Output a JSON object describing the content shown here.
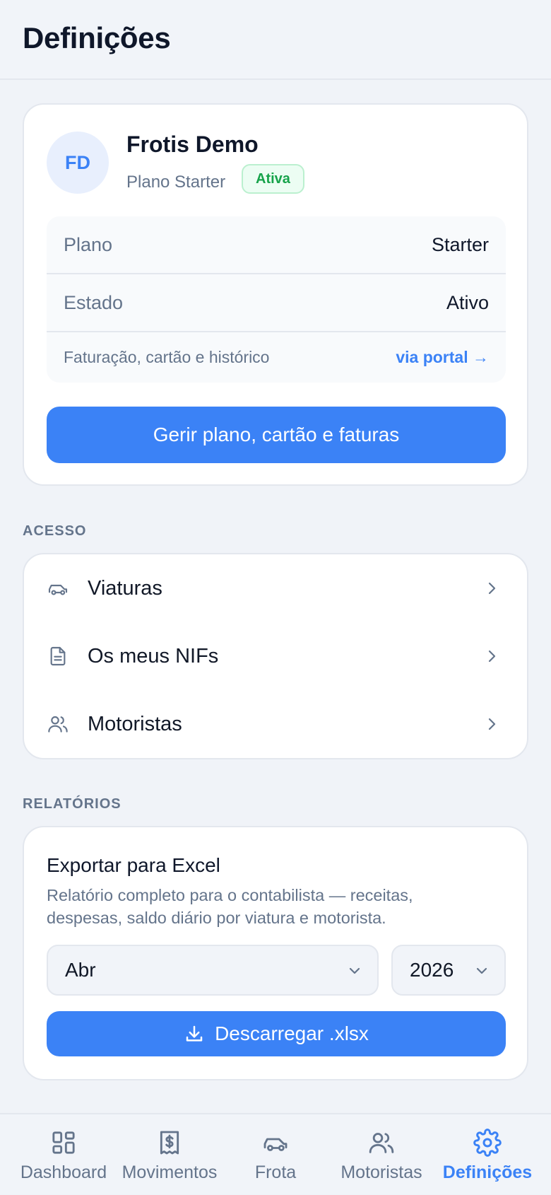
{
  "header": {
    "title": "Definições"
  },
  "account": {
    "initials": "FD",
    "name": "Frotis Demo",
    "plan_line": "Plano Starter",
    "status_badge": "Ativa",
    "details": [
      {
        "label": "Plano",
        "value": "Starter"
      },
      {
        "label": "Estado",
        "value": "Ativo"
      }
    ],
    "billing": {
      "label": "Faturação, cartão e histórico",
      "link": "via portal →"
    },
    "manage_button": "Gerir plano, cartão e faturas"
  },
  "access": {
    "section_label": "ACESSO",
    "items": [
      {
        "label": "Viaturas",
        "icon": "car-icon"
      },
      {
        "label": "Os meus NIFs",
        "icon": "document-icon"
      },
      {
        "label": "Motoristas",
        "icon": "users-icon"
      }
    ]
  },
  "reports": {
    "section_label": "RELATÓRIOS",
    "title": "Exportar para Excel",
    "description": "Relatório completo para o contabilista — receitas, despesas, saldo diário por viatura e motorista.",
    "month": "Abr",
    "year": "2026",
    "download_button": "Descarregar .xlsx"
  },
  "tabbar": {
    "items": [
      {
        "label": "Dashboard",
        "icon": "dashboard-icon",
        "active": false
      },
      {
        "label": "Movimentos",
        "icon": "receipt-icon",
        "active": false
      },
      {
        "label": "Frota",
        "icon": "car-icon",
        "active": false
      },
      {
        "label": "Motoristas",
        "icon": "users-icon",
        "active": false
      },
      {
        "label": "Definições",
        "icon": "gear-icon",
        "active": true
      }
    ]
  },
  "colors": {
    "accent": "#3b82f6",
    "success": "#16a34a",
    "muted": "#64748b",
    "background": "#f0f3f8"
  }
}
